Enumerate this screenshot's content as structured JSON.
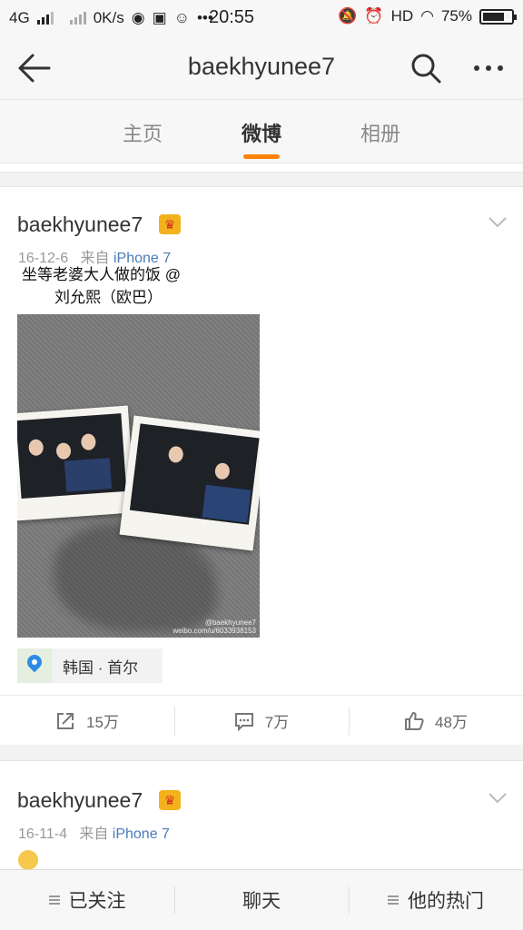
{
  "status_bar": {
    "network": "4G",
    "speed": "0K/s",
    "time": "20:55",
    "hd": "HD",
    "battery": "75%",
    "battery_level": 0.75
  },
  "header": {
    "title": "baekhyunee7"
  },
  "tabs": [
    {
      "label": "主页"
    },
    {
      "label": "微博"
    },
    {
      "label": "相册"
    }
  ],
  "posts": [
    {
      "username": "baekhyunee7",
      "date": "16-12-6",
      "source_prefix": "来自",
      "source": "iPhone 7",
      "text_line1": "坐等老婆大人做的饭 @",
      "text_line2": "刘允熙（欧巴）",
      "watermark_line1": "@baekhyunee7",
      "watermark_line2": "weibo.com/u/6033938153",
      "location": "韩国 · 首尔",
      "reposts": "15万",
      "comments": "7万",
      "likes": "48万"
    },
    {
      "username": "baekhyunee7",
      "date": "16-11-4",
      "source_prefix": "来自",
      "source": "iPhone 7"
    }
  ],
  "bottom_bar": {
    "follow": "已关注",
    "chat": "聊天",
    "hot": "他的热门"
  },
  "colors": {
    "accent": "#ff8200",
    "link": "#4a7ab8"
  }
}
